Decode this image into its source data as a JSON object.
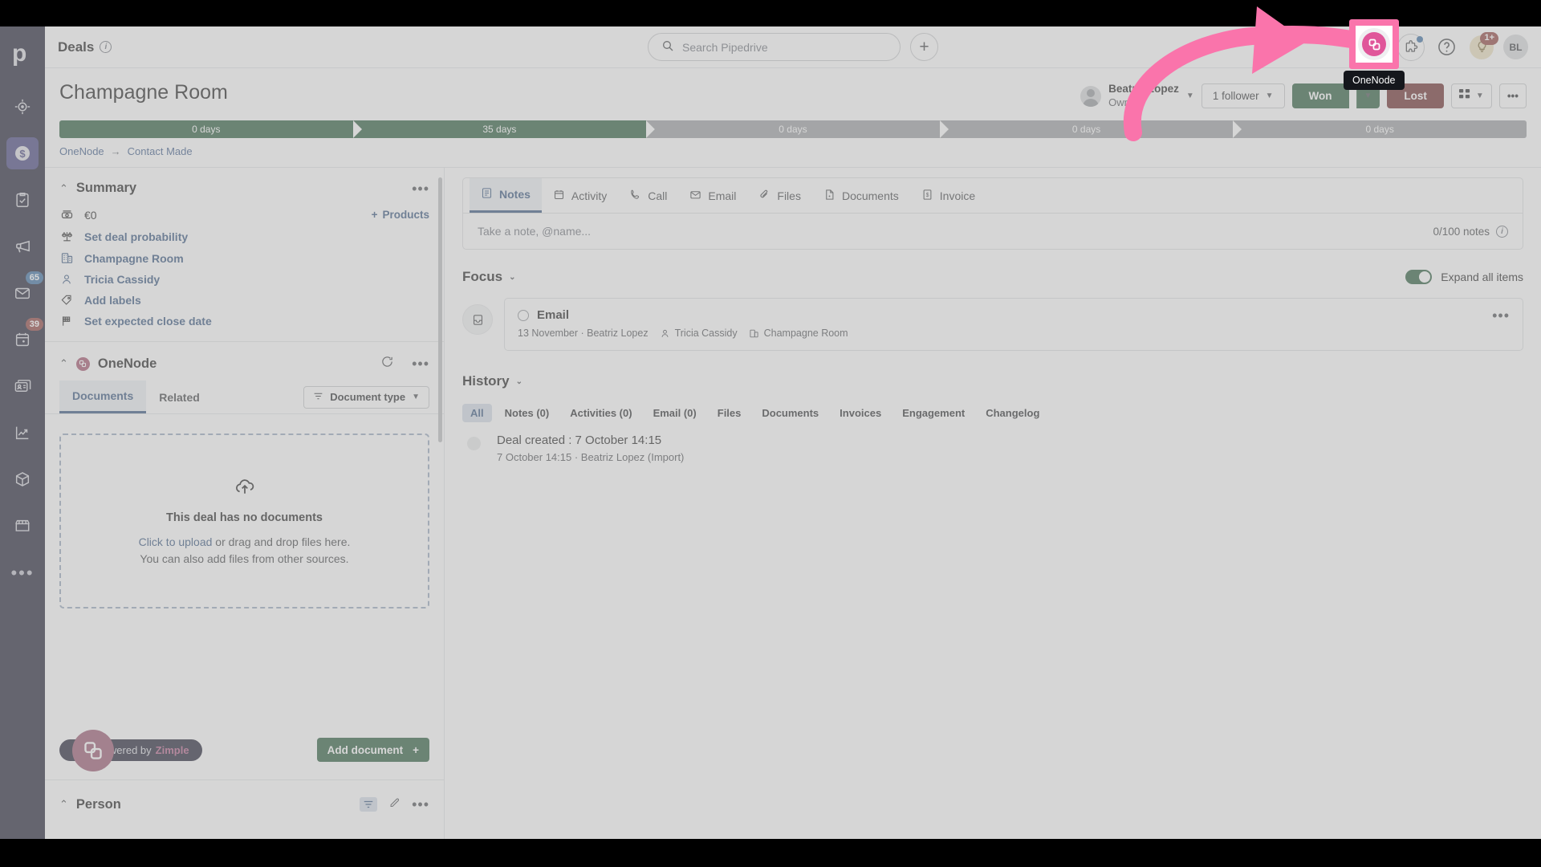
{
  "app": {
    "name": "Pipedrive"
  },
  "rail": {
    "logo": "pipedrive-logo",
    "items": [
      {
        "name": "leads",
        "icon": "target-icon",
        "badge": null,
        "active": false
      },
      {
        "name": "deals",
        "icon": "dollar-coin-icon",
        "badge": null,
        "active": true
      },
      {
        "name": "activities",
        "icon": "clipboard-check-icon",
        "badge": null,
        "active": false
      },
      {
        "name": "campaigns",
        "icon": "megaphone-icon",
        "badge": null,
        "active": false
      },
      {
        "name": "mail",
        "icon": "envelope-icon",
        "badge": "65",
        "badge_color": "#1b72c4",
        "active": false
      },
      {
        "name": "calendar",
        "icon": "calendar-icon",
        "badge": "39",
        "badge_color": "#b5342d",
        "active": false
      },
      {
        "name": "contacts",
        "icon": "contact-cards-icon",
        "badge": null,
        "active": false
      },
      {
        "name": "insights",
        "icon": "chart-trend-icon",
        "badge": null,
        "active": false
      },
      {
        "name": "products",
        "icon": "box-icon",
        "badge": null,
        "active": false
      },
      {
        "name": "marketplace",
        "icon": "storefront-icon",
        "badge": null,
        "active": false
      }
    ],
    "more": "•••"
  },
  "topbar": {
    "title": "Deals",
    "info_tooltip": "i",
    "search_placeholder": "Search Pipedrive",
    "add_label": "+",
    "right_icons": [
      {
        "name": "onenode-app-icon",
        "label": "OneNode"
      },
      {
        "name": "puzzle-apps-icon",
        "label": "Apps",
        "dot": true
      },
      {
        "name": "help-icon",
        "label": "Help"
      },
      {
        "name": "whats-new-icon",
        "label": "What's new",
        "badge": "1+"
      }
    ],
    "avatar_initials": "BL"
  },
  "deal": {
    "title": "Champagne Room",
    "owner_name": "Beatriz Lopez",
    "owner_role": "Owner",
    "followers_label": "1 follower",
    "won_label": "Won",
    "lost_label": "Lost",
    "stages": [
      {
        "label": "0 days",
        "done": true
      },
      {
        "label": "35 days",
        "done": true
      },
      {
        "label": "0 days",
        "done": false
      },
      {
        "label": "0 days",
        "done": false
      },
      {
        "label": "0 days",
        "done": false
      }
    ],
    "breadcrumb": {
      "pipeline": "OneNode",
      "arrow": "→",
      "stage": "Contact Made"
    }
  },
  "summary": {
    "title": "Summary",
    "products_label": "Products",
    "rows": [
      {
        "icon": "money-icon",
        "text": "€0",
        "link": false
      },
      {
        "icon": "scales-icon",
        "text": "Set deal probability",
        "link": true
      },
      {
        "icon": "organization-icon",
        "text": "Champagne Room",
        "link": true
      },
      {
        "icon": "person-icon",
        "text": "Tricia Cassidy",
        "link": true
      },
      {
        "icon": "label-tag-icon",
        "text": "Add labels",
        "link": true
      },
      {
        "icon": "flag-icon",
        "text": "Set expected close date",
        "link": true
      }
    ]
  },
  "onenode_panel": {
    "title": "OneNode",
    "tabs": [
      {
        "label": "Documents",
        "active": true
      },
      {
        "label": "Related",
        "active": false
      }
    ],
    "filter_label": "Document type",
    "empty_title": "This deal has no documents",
    "empty_link": "Click to upload",
    "empty_rest": " or drag and drop files here.",
    "empty_line2": "You can also add files from other sources.",
    "powered_by": "Powered by ",
    "powered_brand": "Zimple",
    "add_document_label": "Add document"
  },
  "person_section": {
    "title": "Person"
  },
  "content": {
    "tabs": [
      {
        "label": "Notes",
        "icon": "note-icon",
        "active": true
      },
      {
        "label": "Activity",
        "icon": "calendar-activity-icon",
        "active": false
      },
      {
        "label": "Call",
        "icon": "phone-icon",
        "active": false
      },
      {
        "label": "Email",
        "icon": "envelope-icon",
        "active": false
      },
      {
        "label": "Files",
        "icon": "paperclip-icon",
        "active": false
      },
      {
        "label": "Documents",
        "icon": "document-icon",
        "active": false
      },
      {
        "label": "Invoice",
        "icon": "invoice-icon",
        "active": false
      }
    ],
    "note_placeholder": "Take a note, @name...",
    "note_count": "0/100 notes",
    "focus": {
      "label": "Focus",
      "toggle_label": "Expand all items",
      "items": [
        {
          "icon": "inbox-icon",
          "title": "Email",
          "date": "13 November · Beatriz Lopez",
          "person": "Tricia Cassidy",
          "org": "Champagne Room"
        }
      ]
    },
    "history": {
      "label": "History",
      "filters": [
        {
          "label": "All",
          "active": true
        },
        {
          "label": "Notes (0)",
          "active": false
        },
        {
          "label": "Activities (0)",
          "active": false
        },
        {
          "label": "Email (0)",
          "active": false
        },
        {
          "label": "Files",
          "active": false
        },
        {
          "label": "Documents",
          "active": false
        },
        {
          "label": "Invoices",
          "active": false
        },
        {
          "label": "Engagement",
          "active": false
        },
        {
          "label": "Changelog",
          "active": false
        }
      ],
      "items": [
        {
          "title": "Deal created : 7 October 14:15",
          "sub": "7 October 14:15 · Beatriz Lopez (Import)"
        }
      ]
    }
  },
  "annotation": {
    "highlight_color": "#fa74ab",
    "tooltip_text": "OneNode",
    "arrow": "curved-arrow-pointing-to-onenode-icon"
  }
}
